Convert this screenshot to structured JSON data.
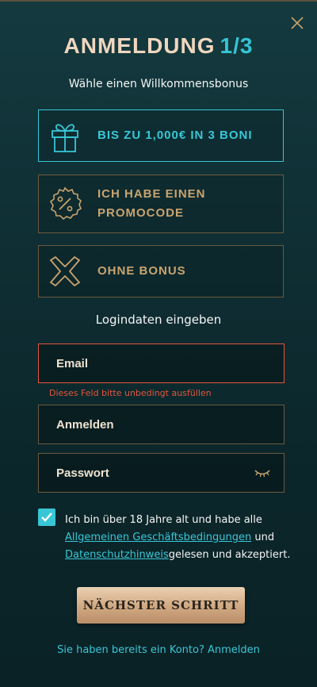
{
  "header": {
    "title": "ANMELDUNG",
    "step": "1/3",
    "subtitle": "Wähle einen Willkommensbonus"
  },
  "bonus_options": [
    {
      "label": "BIS ZU 1,000€ IN 3 BONI",
      "icon": "gift-icon",
      "selected": true
    },
    {
      "label": "ICH HABE EINEN PROMOCODE",
      "icon": "percent-badge-icon",
      "selected": false
    },
    {
      "label": "OHNE BONUS",
      "icon": "x-mark-icon",
      "selected": false
    }
  ],
  "login": {
    "title": "Logindaten eingeben",
    "email_placeholder": "Email",
    "email_error": "Dieses Feld bitte unbedingt ausfüllen",
    "username_placeholder": "Anmelden",
    "password_placeholder": "Passwort"
  },
  "terms": {
    "checked": true,
    "text_before": "Ich bin über 18 Jahre alt und habe alle",
    "link_terms": "Allgemeinen Geschäftsbedingungen",
    "text_and": " und",
    "link_privacy": "Datenschutzhinweis",
    "text_after": "gelesen und akzeptiert."
  },
  "actions": {
    "next_label": "NÄCHSTER SCHRITT",
    "login_link": "Sie haben bereits ein Konto? Anmelden"
  },
  "colors": {
    "accent_cyan": "#38c6d6",
    "gold": "#c9a46f",
    "error": "#e4553b",
    "title": "#efd6bf"
  }
}
